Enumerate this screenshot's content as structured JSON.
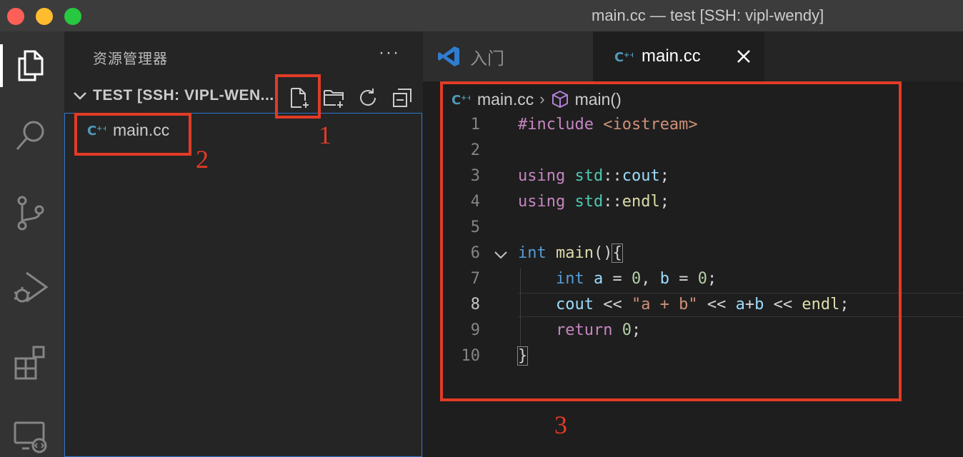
{
  "window": {
    "title": "main.cc — test [SSH: vipl-wendy]"
  },
  "activity_bar": {
    "items": [
      "explorer-icon",
      "search-icon",
      "source-control-icon",
      "run-debug-icon",
      "extensions-icon",
      "remote-explorer-icon"
    ]
  },
  "sidebar": {
    "title": "资源管理器",
    "more": "···",
    "folder": "TEST [SSH: VIPL-WEN...",
    "toolbar": [
      "new-file-icon",
      "new-folder-icon",
      "refresh-icon",
      "collapse-all-icon"
    ],
    "files": [
      {
        "name": "main.cc",
        "icon": "cpp-file-icon"
      }
    ]
  },
  "tabs": [
    {
      "label": "入门",
      "icon": "vscode-logo-icon",
      "active": false
    },
    {
      "label": "main.cc",
      "icon": "cpp-file-icon",
      "active": true
    }
  ],
  "breadcrumb": {
    "file": "main.cc",
    "symbol": "main()"
  },
  "code": {
    "line_numbers": [
      "1",
      "2",
      "3",
      "4",
      "5",
      "6",
      "7",
      "8",
      "9",
      "10"
    ],
    "active_line": "8"
  },
  "annotations": {
    "labels": [
      "1",
      "2",
      "3"
    ],
    "color": "#e23b26"
  },
  "colors": {
    "accent": "#2f78d0",
    "activity_bar": "#333333",
    "sidebar": "#252526",
    "editor": "#1e1e1e"
  }
}
